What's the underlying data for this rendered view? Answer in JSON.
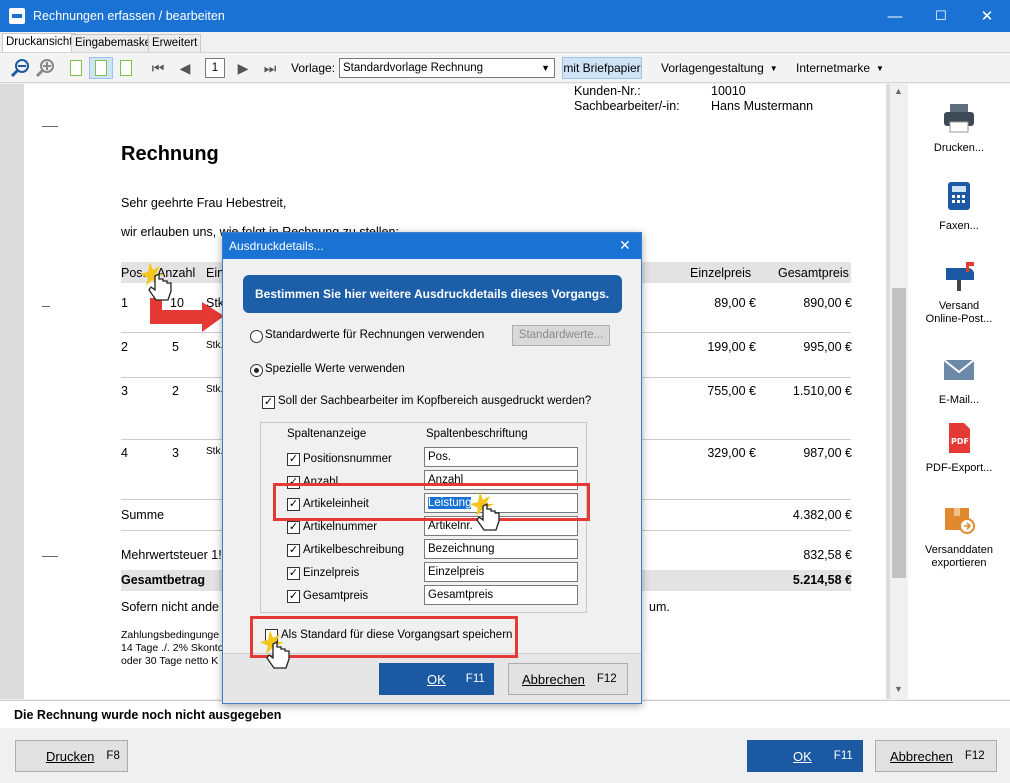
{
  "window": {
    "title": "Rechnungen erfassen / bearbeiten",
    "minimize": "—",
    "maximize": "☐",
    "close": "✕"
  },
  "tabs": [
    "Druckansicht",
    "Eingabemaske",
    "Erweitert"
  ],
  "toolbar": {
    "page_number": "1",
    "vorlage_label": "Vorlage:",
    "vorlage_value": "Standardvorlage Rechnung",
    "briefpapier": "mit Briefpapier",
    "vorlagengestaltung": "Vorlagengestaltung",
    "internetmarke": "Internetmarke"
  },
  "document": {
    "kunden_label": "Kunden-Nr.:",
    "kunden_value": "10010",
    "sachbearbeiter_label": "Sachbearbeiter/-in:",
    "sachbearbeiter_value": "Hans Mustermann",
    "heading": "Rechnung",
    "greeting": "Sehr geehrte Frau Hebestreit,",
    "intro": "wir erlauben uns, wie folgt in Rechnung zu stellen:",
    "col_pos": "Pos.",
    "col_anzahl": "Anzahl",
    "col_ein": "Ein",
    "col_einzelpreis": "Einzelpreis",
    "col_gesamtpreis": "Gesamtpreis",
    "rows": [
      {
        "pos": "1",
        "anzahl": "10",
        "einheit": "Stk",
        "einzel": "89,00 €",
        "gesamt": "890,00 €"
      },
      {
        "pos": "2",
        "anzahl": "5",
        "einheit": "Stk.",
        "einzel": "199,00 €",
        "gesamt": "995,00 €"
      },
      {
        "pos": "3",
        "anzahl": "2",
        "einheit": "Stk.",
        "einzel": "755,00 €",
        "gesamt": "1.510,00 €"
      },
      {
        "pos": "4",
        "anzahl": "3",
        "einheit": "Stk.",
        "einzel": "329,00 €",
        "gesamt": "987,00 €"
      }
    ],
    "summe_label": "Summe",
    "summe_value": "4.382,00 €",
    "mwst_label": "Mehrwertsteuer 1!",
    "mwst_value": "832,58 €",
    "gesamt_label": "Gesamtbetrag",
    "gesamt_value": "5.214,58 €",
    "sofern": "Sofern nicht ande",
    "sofern_end": "um.",
    "zahlung1": "Zahlungsbedingunge",
    "zahlung2": "14 Tage ./. 2% Skonto",
    "zahlung3": "oder 30 Tage netto K"
  },
  "right_panel": [
    {
      "label1": "Drucken...",
      "label2": "",
      "icon": "printer-icon"
    },
    {
      "label1": "Faxen...",
      "label2": "",
      "icon": "fax-icon"
    },
    {
      "label1": "Versand",
      "label2": "Online-Post...",
      "icon": "mailbox-icon"
    },
    {
      "label1": "E-Mail...",
      "label2": "",
      "icon": "envelope-icon"
    },
    {
      "label1": "PDF-Export...",
      "label2": "",
      "icon": "pdf-icon"
    },
    {
      "label1": "Versanddaten",
      "label2": "exportieren",
      "icon": "package-icon"
    }
  ],
  "status_text": "Die Rechnung wurde noch nicht ausgegeben",
  "bottom": {
    "drucken": "Drucken",
    "drucken_key": "F8",
    "ok": "OK",
    "ok_key": "F11",
    "abbrechen": "Abbrechen",
    "abbrechen_key": "F12"
  },
  "dialog": {
    "title": "Ausdruckdetails...",
    "banner": "Bestimmen Sie hier weitere Ausdruckdetails dieses Vorgangs.",
    "radio_standard": "Standardwerte für Rechnungen verwenden",
    "standardwerte_btn": "Standardwerte...",
    "radio_speziell": "Spezielle Werte verwenden",
    "sachbearbeiter_cb": "Soll der Sachbearbeiter im Kopfbereich ausgedruckt werden?",
    "col1": "Spaltenanzeige",
    "col2": "Spaltenbeschriftung",
    "columns": [
      {
        "name": "Positionsnummer",
        "value": "Pos."
      },
      {
        "name": "Anzahl",
        "value": "Anzahl"
      },
      {
        "name": "Artikeleinheit",
        "value": "Leistung"
      },
      {
        "name": "Artikelnummer",
        "value": "Artikelnr."
      },
      {
        "name": "Artikelbeschreibung",
        "value": "Bezeichnung"
      },
      {
        "name": "Einzelpreis",
        "value": "Einzelpreis"
      },
      {
        "name": "Gesamtpreis",
        "value": "Gesamtpreis"
      }
    ],
    "als_standard": "Als Standard für diese Vorgangsart speichern",
    "ok": "OK",
    "ok_key": "F11",
    "abbrechen": "Abbrechen",
    "abbrechen_key": "F12"
  },
  "colors": {
    "accent": "#1a73d4",
    "button_primary": "#1b5aa3",
    "highlight_red": "#e53935"
  }
}
